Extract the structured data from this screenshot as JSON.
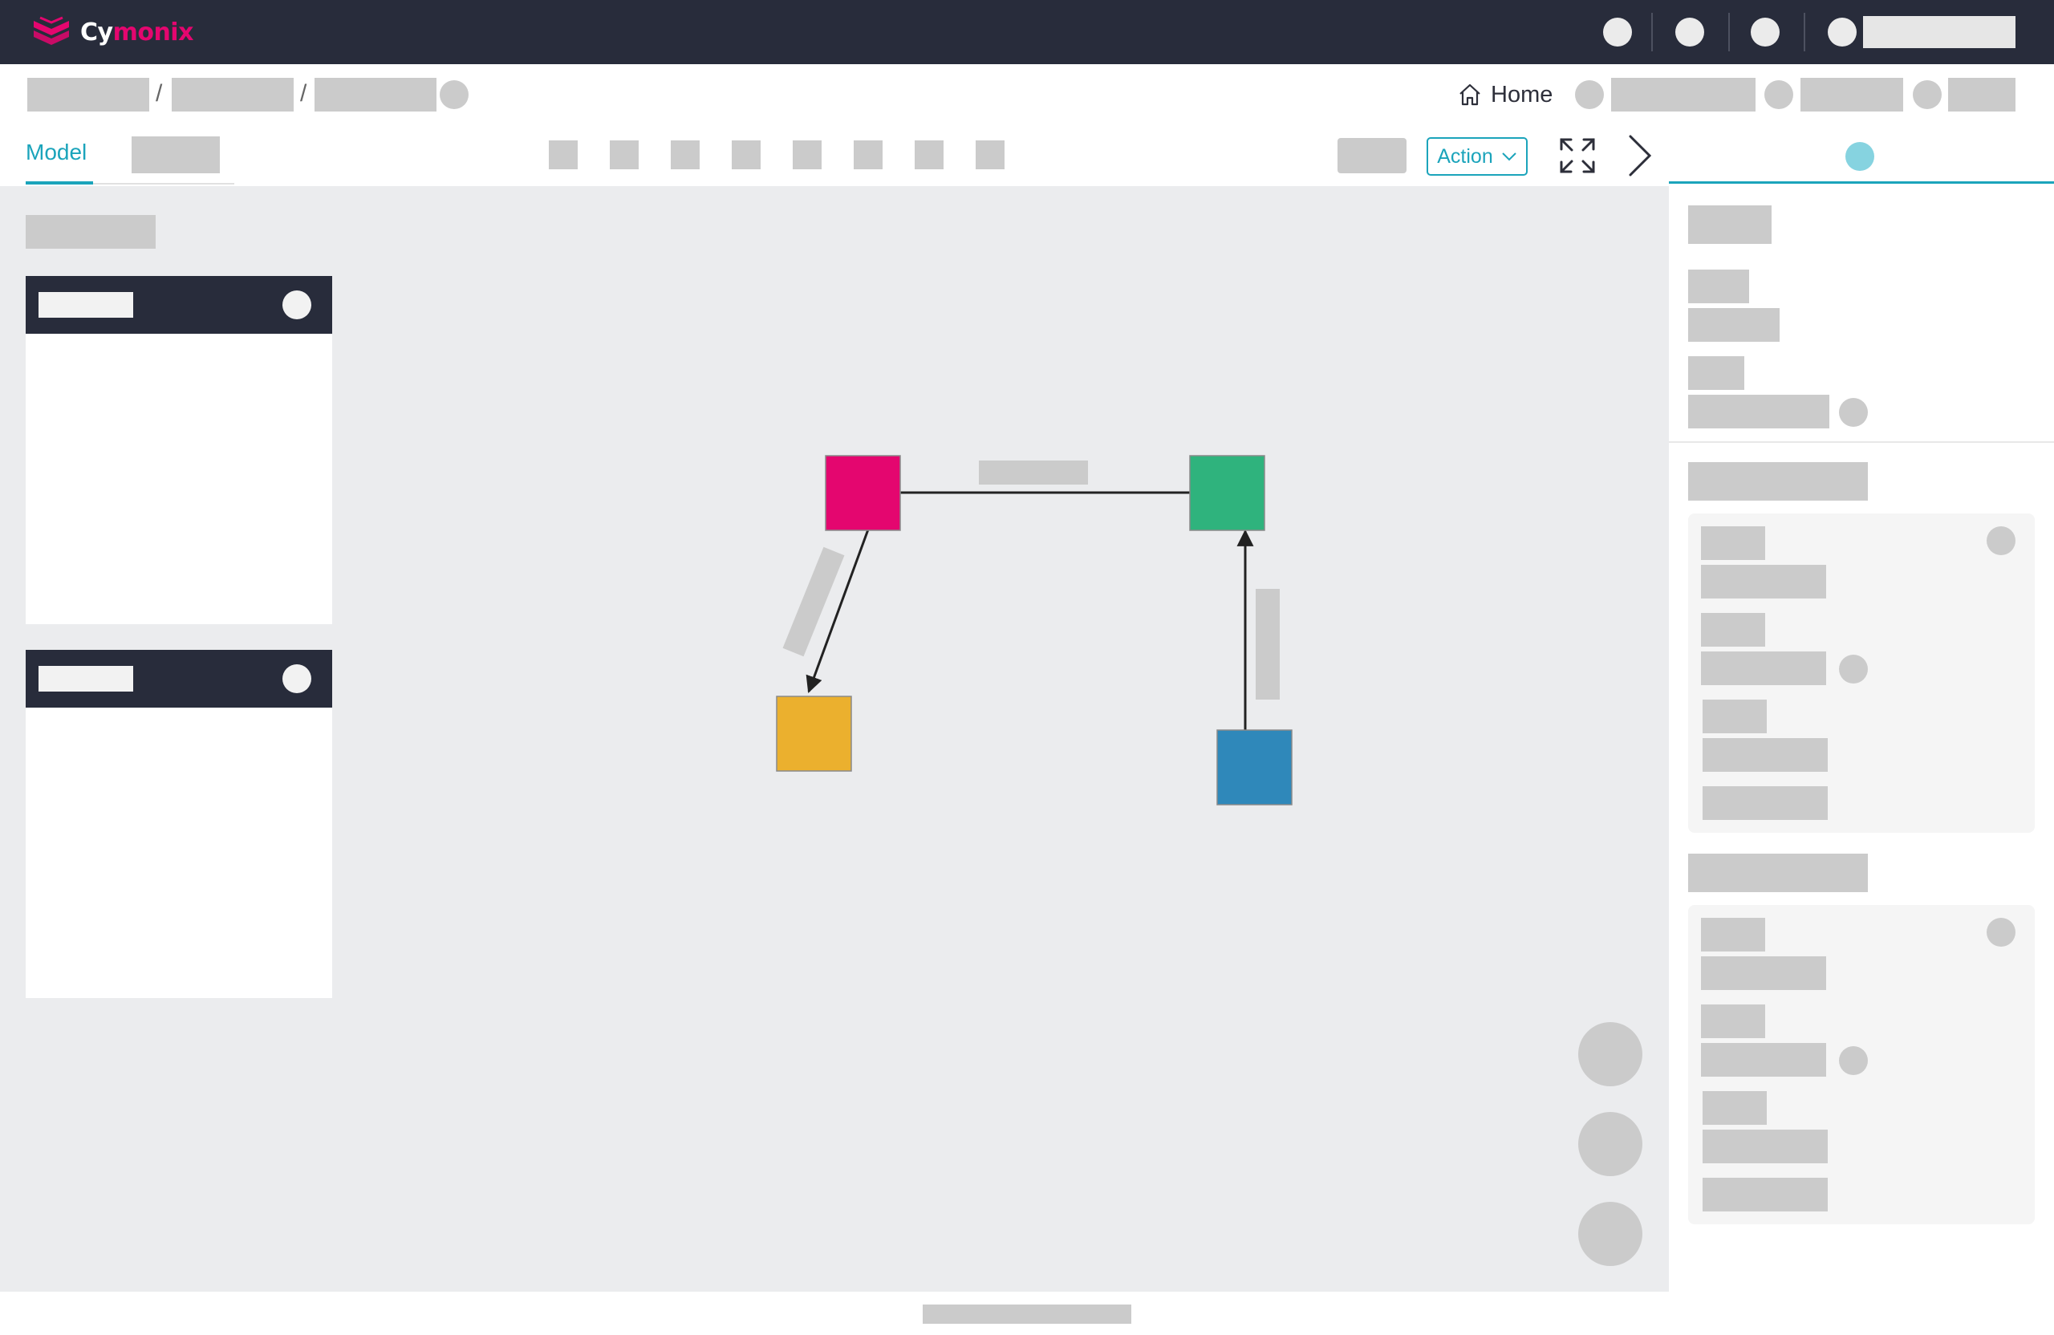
{
  "brand": {
    "name_prefix": "Cy",
    "name_suffix": "monix",
    "colors": {
      "topbar": "#282c3b",
      "accent": "#1ba4bb",
      "brand_pink": "#e4066f"
    }
  },
  "header": {
    "home_label": "Home"
  },
  "tabs": {
    "active_label": "Model"
  },
  "toolbar": {
    "action_label": "Action"
  },
  "diagram": {
    "nodes": [
      {
        "id": "pink",
        "color": "#e4066f"
      },
      {
        "id": "green",
        "color": "#2fb37d"
      },
      {
        "id": "yellow",
        "color": "#ebb02e"
      },
      {
        "id": "blue",
        "color": "#2f88ba"
      }
    ],
    "edges": [
      {
        "from": "pink",
        "to": "green",
        "arrow": false
      },
      {
        "from": "pink",
        "to": "yellow",
        "arrow": true
      },
      {
        "from": "blue",
        "to": "green",
        "arrow": true
      }
    ]
  }
}
